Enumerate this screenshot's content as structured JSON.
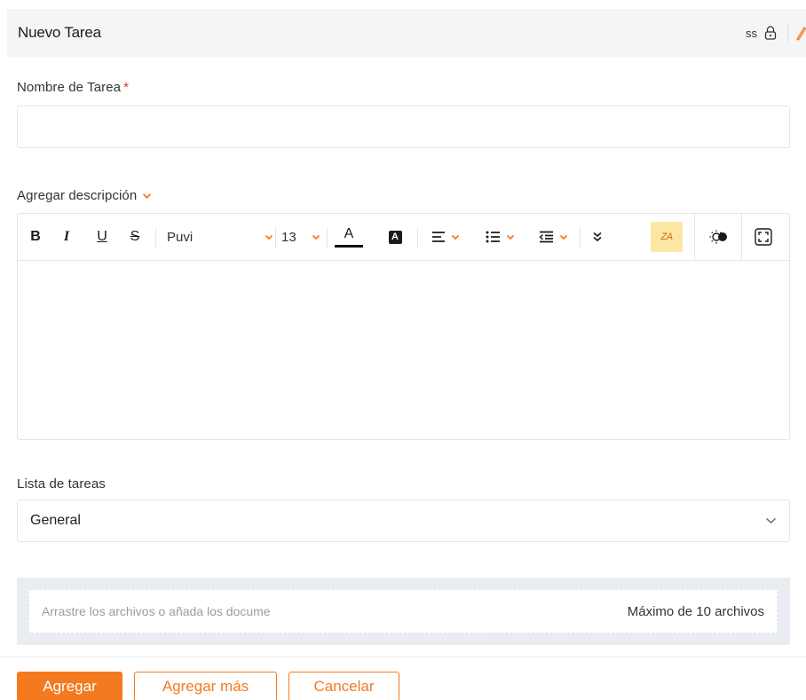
{
  "header": {
    "title": "Nuevo Tarea",
    "user": "ss"
  },
  "task_name": {
    "label": "Nombre de Tarea",
    "required_mark": "*",
    "value": ""
  },
  "description": {
    "label": "Agregar descripción",
    "toolbar": {
      "font_name": "Puvi",
      "font_size": "13",
      "text_color_glyph": "A",
      "highlight_glyph": "A",
      "translate_glyph": "ZA"
    }
  },
  "task_list": {
    "label": "Lista de tareas",
    "selected": "General"
  },
  "upload": {
    "placeholder": "Arrastre los archivos o añada los docume",
    "max": "Máximo de 10 archivos"
  },
  "buttons": {
    "add": "Agregar",
    "add_more": "Agregar más",
    "cancel": "Cancelar"
  },
  "colors": {
    "accent": "#f47a20",
    "required": "#e0301e",
    "header_bg": "#f4f5f7",
    "upload_bg": "#e9ecf1",
    "highlight_bg": "#fbe7a3"
  },
  "icons": [
    "lock-icon",
    "pencil-icon",
    "chevron-down-icon",
    "bold-icon",
    "italic-icon",
    "underline-icon",
    "strikethrough-icon",
    "text-color-icon",
    "highlight-color-icon",
    "align-icon",
    "list-icon",
    "indent-icon",
    "more-icon",
    "translate-icon",
    "theme-toggle-icon",
    "fullscreen-icon"
  ]
}
